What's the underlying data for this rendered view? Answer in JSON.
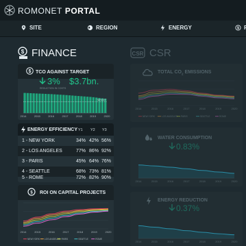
{
  "header": {
    "brand_light": "ROMONET",
    "brand_bold": "PORTAL"
  },
  "nav": [
    {
      "label": "SITE",
      "icon": "location-pin-icon"
    },
    {
      "label": "REGION",
      "icon": "globe-icon"
    },
    {
      "label": "ENERGY",
      "icon": "lightning-icon"
    },
    {
      "label": "F",
      "icon": "finance-icon"
    }
  ],
  "finance": {
    "title": "FINANCE",
    "tco": {
      "title": "TCO AGAINST TARGET",
      "pct": "3%",
      "amount": "$3.7bn.",
      "sub_note": "REDUCTION IN COSTS",
      "target_label": "TARGET",
      "years": [
        "2014",
        "2015",
        "2016",
        "2017",
        "2018",
        "2019",
        "2020"
      ]
    },
    "energy_efficiency": {
      "title": "ENERGY EFFICIENCY",
      "columns": [
        "Y1",
        "Y2",
        "Y3"
      ],
      "rows": [
        {
          "city": "1 - NEW YORK",
          "values": [
            "34%",
            "42%",
            "56%"
          ]
        },
        {
          "city": "2 - LOS ANGELES",
          "values": [
            "77%",
            "86%",
            "92%"
          ]
        },
        {
          "city": "3 - PARIS",
          "values": [
            "45%",
            "64%",
            "76%"
          ]
        },
        {
          "city": "4 - SEATTLE",
          "values": [
            "68%",
            "73%",
            "81%"
          ]
        },
        {
          "city": "5 - ROME",
          "values": [
            "72%",
            "82%",
            "90%"
          ]
        }
      ]
    },
    "roi": {
      "title": "ROI ON CAPITAL PROJECTS",
      "years": [
        "2014",
        "2015",
        "2016",
        "2017",
        "2018",
        "2019",
        "2020"
      ],
      "legend": [
        "NEW YORK",
        "LOS ANGELES",
        "PARIS",
        "SEATTLE",
        "ROME"
      ]
    }
  },
  "csr": {
    "title": "CSR",
    "icon_label": "CSR",
    "co2": {
      "title_prefix": "TOTAL CO",
      "title_sub": "2",
      "title_suffix": " EMISSIONS",
      "years": [
        "2014",
        "2015",
        "2016",
        "2017",
        "2018",
        "2019",
        "2020"
      ],
      "legend": [
        "NEW YORK",
        "LOS ANGELES",
        "PARIS",
        "SEATTLE",
        "ROME"
      ]
    },
    "water": {
      "title": "WATER CONSUMPTION",
      "stat": "0.83%",
      "years": [
        "2014",
        "2015",
        "2016",
        "2017",
        "2018",
        "2019",
        "2020"
      ]
    },
    "energy_reduction": {
      "title": "ENERGY REDUCTION",
      "stat": "0.37%",
      "years": [
        "2014",
        "2015",
        "2016",
        "2017",
        "2018",
        "2019",
        "2020"
      ]
    }
  },
  "colors": {
    "accent_green": "#21c38a",
    "bar_green": "#1fa57c",
    "series": [
      "#e0455a",
      "#f0a54a",
      "#c6d94a",
      "#42c0c8",
      "#e06ad0"
    ]
  },
  "chart_data": [
    {
      "type": "bar",
      "title": "TCO AGAINST TARGET",
      "categories": [
        "2014",
        "2015",
        "2016",
        "2017",
        "2018",
        "2019",
        "2020"
      ],
      "values": [
        0.98,
        0.95,
        0.92,
        0.88,
        0.83,
        0.78,
        0.7
      ],
      "target": 0.55
    },
    {
      "type": "line",
      "title": "ROI ON CAPITAL PROJECTS",
      "x": [
        "2014",
        "2015",
        "2016",
        "2017",
        "2018",
        "2019",
        "2020"
      ],
      "series": [
        {
          "name": "NEW YORK",
          "values": [
            0.3,
            0.45,
            0.58,
            0.68,
            0.74,
            0.77,
            0.78
          ]
        },
        {
          "name": "LOS ANGELES",
          "values": [
            0.25,
            0.4,
            0.53,
            0.63,
            0.7,
            0.74,
            0.76
          ]
        },
        {
          "name": "PARIS",
          "values": [
            0.2,
            0.34,
            0.47,
            0.58,
            0.66,
            0.71,
            0.73
          ]
        },
        {
          "name": "SEATTLE",
          "values": [
            0.15,
            0.28,
            0.41,
            0.52,
            0.61,
            0.67,
            0.7
          ]
        },
        {
          "name": "ROME",
          "values": [
            0.1,
            0.22,
            0.35,
            0.47,
            0.57,
            0.64,
            0.68
          ]
        }
      ]
    },
    {
      "type": "line",
      "title": "TOTAL CO2 EMISSIONS",
      "x": [
        "2014",
        "2015",
        "2016",
        "2017",
        "2018",
        "2019",
        "2020"
      ],
      "series": [
        {
          "name": "NEW YORK",
          "values": [
            0.5,
            0.62,
            0.66,
            0.6,
            0.5,
            0.42,
            0.38
          ]
        },
        {
          "name": "LOS ANGELES",
          "values": [
            0.4,
            0.55,
            0.6,
            0.56,
            0.47,
            0.4,
            0.36
          ]
        },
        {
          "name": "PARIS",
          "values": [
            0.35,
            0.48,
            0.55,
            0.52,
            0.44,
            0.37,
            0.33
          ]
        },
        {
          "name": "SEATTLE",
          "values": [
            0.3,
            0.42,
            0.5,
            0.48,
            0.41,
            0.34,
            0.3
          ]
        },
        {
          "name": "ROME",
          "values": [
            0.25,
            0.38,
            0.46,
            0.45,
            0.38,
            0.31,
            0.27
          ]
        }
      ]
    },
    {
      "type": "area",
      "title": "WATER CONSUMPTION",
      "x": [
        "2014",
        "2015",
        "2016",
        "2017",
        "2018",
        "2019",
        "2020"
      ],
      "values": [
        0.6,
        0.56,
        0.5,
        0.43,
        0.35,
        0.28,
        0.22
      ]
    },
    {
      "type": "area",
      "title": "ENERGY REDUCTION",
      "x": [
        "2014",
        "2015",
        "2016",
        "2017",
        "2018",
        "2019",
        "2020"
      ],
      "values": [
        0.62,
        0.55,
        0.47,
        0.38,
        0.3,
        0.23,
        0.18
      ]
    }
  ]
}
